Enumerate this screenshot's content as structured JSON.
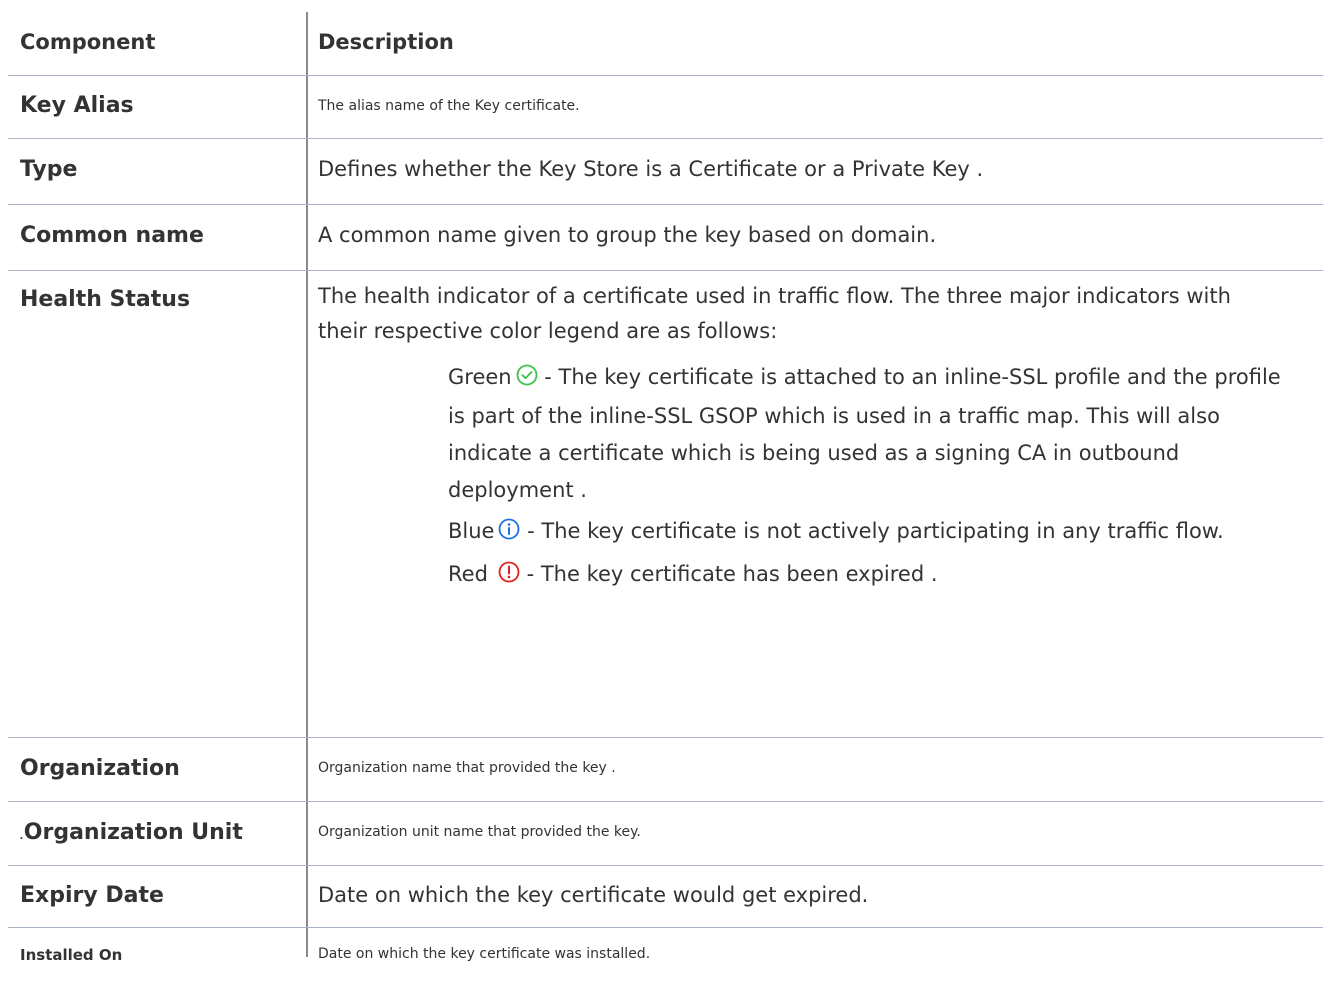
{
  "header": {
    "component": "Component",
    "description": "Description"
  },
  "rows": [
    {
      "component": "Key Alias",
      "description": "The alias name of the Key certificate."
    },
    {
      "component": "Type",
      "description": "Defines whether the Key Store is a Certificate or a Private Key ."
    },
    {
      "component": "Common name",
      "description": "A common name given to group the key based on domain."
    },
    {
      "component": "Health Status",
      "description": "The health indicator of a certificate used in traffic flow. The three major indicators with their respective color legend are as follows:",
      "legend": [
        {
          "color_name": "Green",
          "icon": "check-circle-icon",
          "color": "#3cc24a",
          "text": " - The key certificate is attached to an inline-SSL profile and the profile is part of the inline-SSL GSOP which is used in a traffic map. This will also indicate a certificate which is being used as a signing CA in outbound deployment ."
        },
        {
          "color_name": "Blue",
          "icon": "info-circle-icon",
          "color": "#1f6fe5",
          "text": " - The key certificate is not actively participating in any traffic flow."
        },
        {
          "color_name": "Red",
          "icon": "exclamation-circle-icon",
          "color": "#e02020",
          "text": " - The key certificate has been expired ."
        }
      ]
    },
    {
      "component": "Organization",
      "description": "Organization name that provided the key ."
    },
    {
      "component_prefix": ".",
      "component": "Organization Unit",
      "description": "Organization unit name that provided the key."
    },
    {
      "component": "Expiry Date",
      "description": "Date on which the key certificate would get expired."
    },
    {
      "component": "Installed On",
      "description": "Date on which the key certificate was installed."
    }
  ]
}
